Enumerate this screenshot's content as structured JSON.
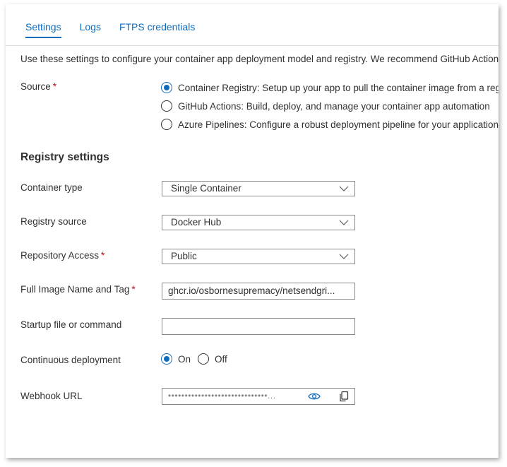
{
  "tabs": [
    {
      "label": "Settings",
      "active": true
    },
    {
      "label": "Logs",
      "active": false
    },
    {
      "label": "FTPS credentials",
      "active": false
    }
  ],
  "intro_text": "Use these settings to configure your container app deployment model and registry. We recommend GitHub Actions",
  "source": {
    "label": "Source",
    "required": "*",
    "options": [
      {
        "text": "Container Registry: Setup up your app to pull the container image from a registry",
        "checked": true
      },
      {
        "text": "GitHub Actions: Build, deploy, and manage your container app automation",
        "checked": false
      },
      {
        "text": "Azure Pipelines: Configure a robust deployment pipeline for your application",
        "checked": false
      }
    ]
  },
  "registry": {
    "title": "Registry settings",
    "container_type": {
      "label": "Container type",
      "value": "Single Container"
    },
    "registry_source": {
      "label": "Registry source",
      "value": "Docker Hub"
    },
    "repository_access": {
      "label": "Repository Access",
      "required": "*",
      "value": "Public"
    },
    "full_image": {
      "label": "Full Image Name and Tag",
      "required": "*",
      "value": "ghcr.io/osbornesupremacy/netsendgri..."
    },
    "startup": {
      "label": "Startup file or command",
      "value": ""
    },
    "continuous_deployment": {
      "label": "Continuous deployment",
      "on_label": "On",
      "off_label": "Off",
      "selected": "On"
    },
    "webhook": {
      "label": "Webhook URL",
      "masked_value": "••••••••••••••••••••••••••••••..."
    }
  },
  "icons": {
    "show": "eye-icon",
    "copy": "copy-icon",
    "dropdown": "chevron-down-icon"
  },
  "colors": {
    "accent": "#0f6cbd",
    "required": "#c50f1f",
    "text": "#323130",
    "border": "#8a8886"
  }
}
